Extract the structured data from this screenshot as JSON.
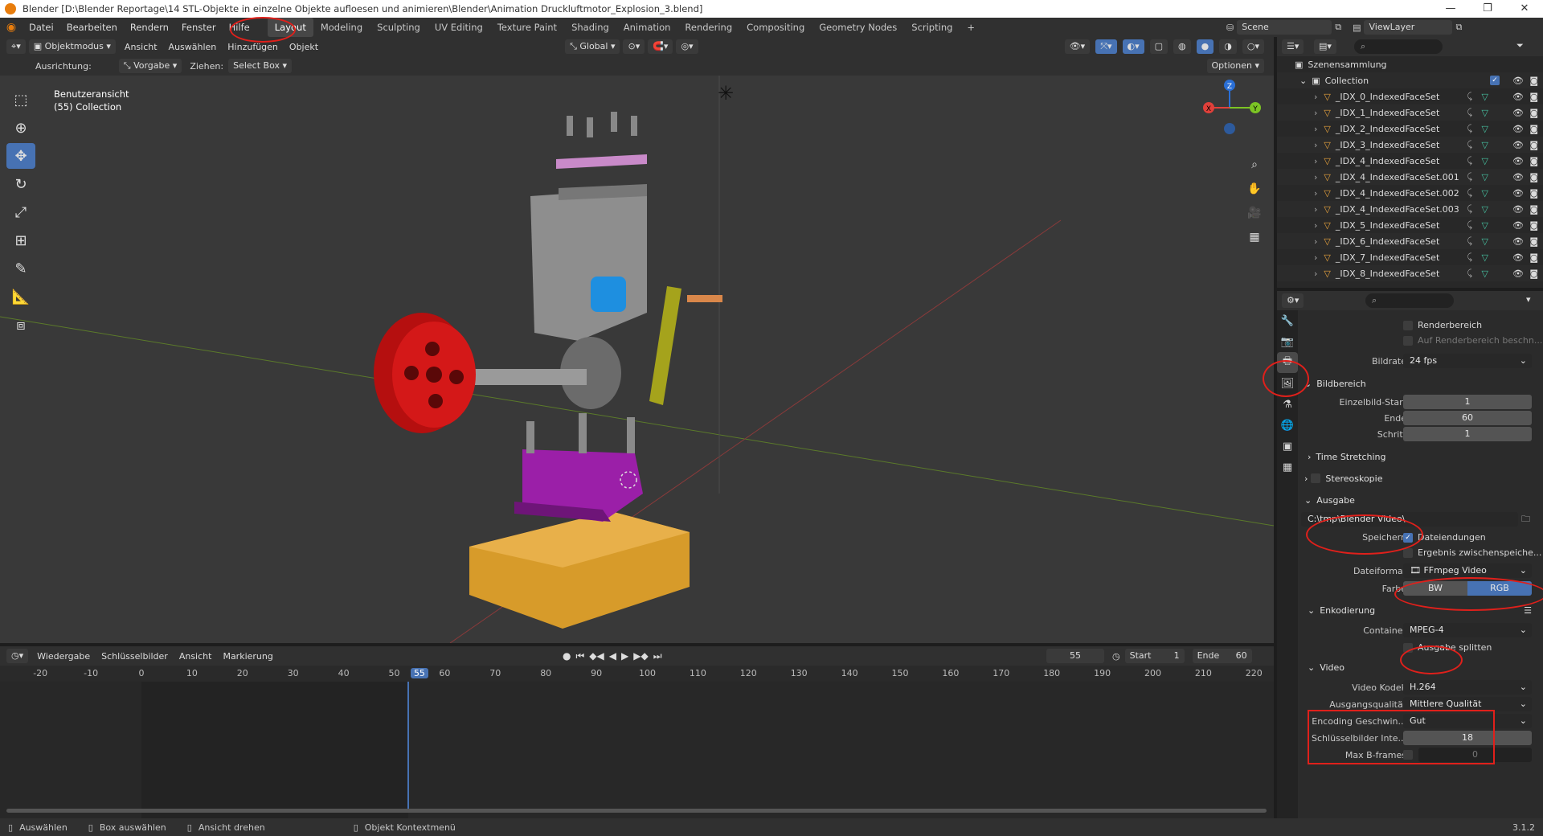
{
  "window": {
    "title": "Blender [D:\\Blender Reportage\\14 STL-Objekte in einzelne Objekte aufloesen und animieren\\Blender\\Animation Druckluftmotor_Explosion_3.blend]",
    "minimize": "—",
    "maximize": "❐",
    "close": "✕"
  },
  "menu": [
    "Datei",
    "Bearbeiten",
    "Rendern",
    "Fenster",
    "Hilfe"
  ],
  "workspaces": [
    "Layout",
    "Modeling",
    "Sculpting",
    "UV Editing",
    "Texture Paint",
    "Shading",
    "Animation",
    "Rendering",
    "Compositing",
    "Geometry Nodes",
    "Scripting"
  ],
  "add_workspace": "+",
  "scene": {
    "name": "Scene",
    "view_layer": "ViewLayer"
  },
  "viewport_header": {
    "mode": "Objektmodus",
    "menus": [
      "Ansicht",
      "Auswählen",
      "Hinzufügen",
      "Objekt"
    ],
    "transform": "Global",
    "options": "Optionen"
  },
  "tool_settings": {
    "orientation_label": "Ausrichtung:",
    "orientation_value": "Vorgabe",
    "drag_label": "Ziehen:",
    "drag_value": "Select Box"
  },
  "viewport": {
    "view_name": "Benutzeransicht",
    "collection": "(55) Collection",
    "gizmo_axes": {
      "x": "X",
      "y": "Y",
      "z": "Z"
    }
  },
  "timeline": {
    "menus": [
      "Wiedergabe",
      "Schlüsselbilder",
      "Ansicht",
      "Markierung"
    ],
    "current_frame": "55",
    "start_label": "Start",
    "start": "1",
    "end_label": "Ende",
    "end": "60",
    "ruler": [
      "-20",
      "-10",
      "0",
      "10",
      "20",
      "30",
      "40",
      "50",
      "55",
      "60",
      "70",
      "80",
      "90",
      "100",
      "110",
      "120",
      "130",
      "140",
      "150",
      "160",
      "170",
      "180",
      "190",
      "200",
      "210",
      "220"
    ]
  },
  "statusbar": {
    "items": [
      "Auswählen",
      "Box auswählen",
      "Ansicht drehen",
      "Objekt Kontextmenü"
    ],
    "version": "3.1.2"
  },
  "outliner": {
    "scene_collection": "Szenensammlung",
    "collection": "Collection",
    "objects": [
      "_IDX_0_IndexedFaceSet",
      "_IDX_1_IndexedFaceSet",
      "_IDX_2_IndexedFaceSet",
      "_IDX_3_IndexedFaceSet",
      "_IDX_4_IndexedFaceSet",
      "_IDX_4_IndexedFaceSet.001",
      "_IDX_4_IndexedFaceSet.002",
      "_IDX_4_IndexedFaceSet.003",
      "_IDX_5_IndexedFaceSet",
      "_IDX_6_IndexedFaceSet",
      "_IDX_7_IndexedFaceSet",
      "_IDX_8_IndexedFaceSet"
    ]
  },
  "properties": {
    "render_region": "Renderbereich",
    "crop_region": "Auf Renderbereich beschn...",
    "framerate_label": "Bildrate",
    "framerate": "24 fps",
    "frame_range": "Bildbereich",
    "frame_start_label": "Einzelbild-Start",
    "frame_start": "1",
    "frame_end_label": "Ende",
    "frame_end": "60",
    "frame_step_label": "Schritt",
    "frame_step": "1",
    "time_stretching": "Time Stretching",
    "stereoscopy": "Stereoskopie",
    "output": "Ausgabe",
    "output_path": "C:\\tmp\\Blender Video\\",
    "save_label": "Speichern",
    "file_extensions": "Dateiendungen",
    "cache_result": "Ergebnis zwischenspeiche...",
    "file_format_label": "Dateiformat",
    "file_format": "FFmpeg Video",
    "color_label": "Farbe",
    "color_bw": "BW",
    "color_rgb": "RGB",
    "encoding": "Enkodierung",
    "container_label": "Container",
    "container": "MPEG-4",
    "split_output": "Ausgabe splitten",
    "video": "Video",
    "video_codec_label": "Video Kodek",
    "video_codec": "H.264",
    "output_quality_label": "Ausgangsqualität",
    "output_quality": "Mittlere Qualität",
    "encoding_speed_label": "Encoding Geschwin...",
    "encoding_speed": "Gut",
    "keyframe_interval_label": "Schlüsselbilder Inte...",
    "keyframe_interval": "18",
    "max_bframes_label": "Max B-frames",
    "max_bframes": "0"
  },
  "colors": {
    "accent": "#4772b3",
    "annotation": "#e0201b",
    "object_orange": "#e8a33d"
  }
}
